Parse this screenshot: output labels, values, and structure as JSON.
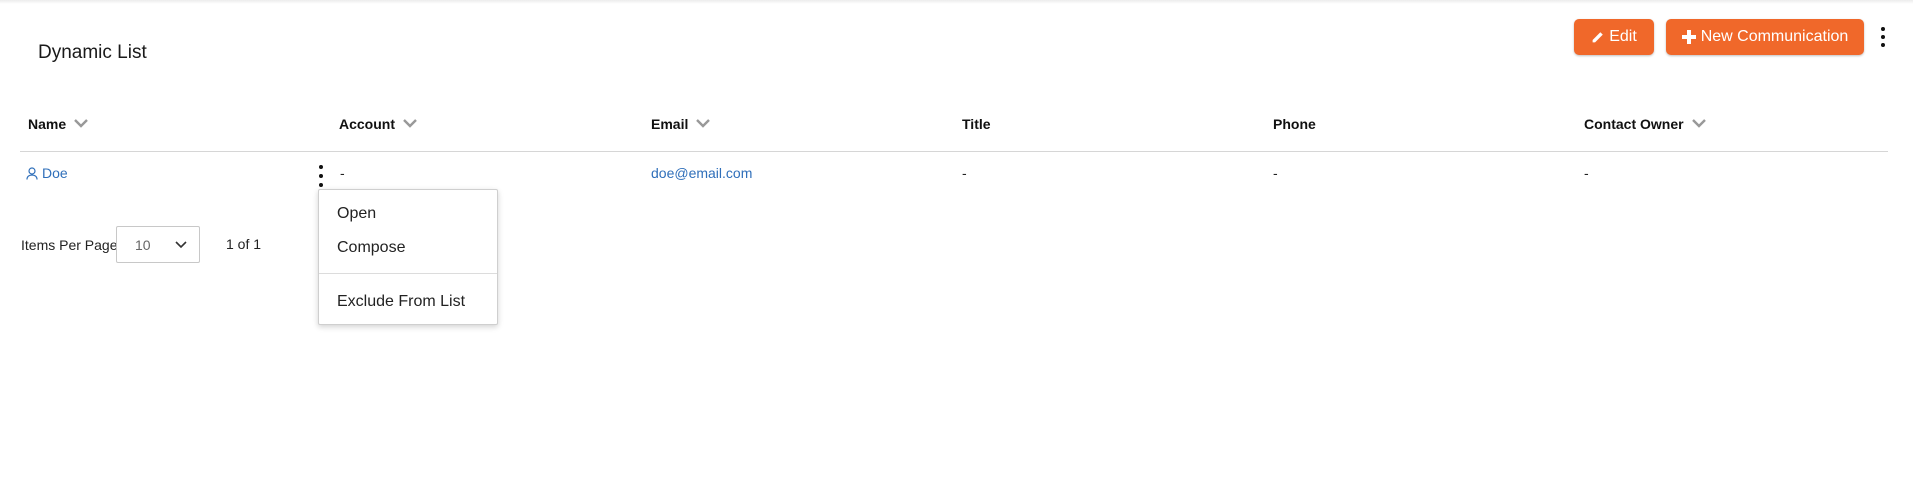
{
  "page": {
    "title": "Dynamic List"
  },
  "toolbar": {
    "edit_label": "Edit",
    "new_label": "New Communication",
    "accent_color": "#f0682a"
  },
  "table": {
    "columns": [
      {
        "label": "Name",
        "sortable": true
      },
      {
        "label": "Account",
        "sortable": true
      },
      {
        "label": "Email",
        "sortable": true
      },
      {
        "label": "Title",
        "sortable": false
      },
      {
        "label": "Phone",
        "sortable": false
      },
      {
        "label": "Contact Owner",
        "sortable": true
      }
    ],
    "rows": [
      {
        "name": "Doe",
        "account": "-",
        "email": "doe@email.com",
        "title": "-",
        "phone": "-",
        "owner": "-"
      }
    ]
  },
  "pager": {
    "items_per_page_label": "Items Per Page",
    "items_per_page_value": "10",
    "page_count": "1 of 1"
  },
  "context_menu": {
    "items": [
      "Open",
      "Compose",
      "Exclude From List"
    ]
  },
  "icons": {
    "edit": "pencil-icon",
    "new": "plus-icon",
    "more": "vertical-dots-icon",
    "sort": "chevron-down-icon",
    "contact": "person-icon",
    "select": "chevron-down-icon"
  },
  "colors": {
    "link": "#2f6fba",
    "accent": "#f0682a"
  }
}
